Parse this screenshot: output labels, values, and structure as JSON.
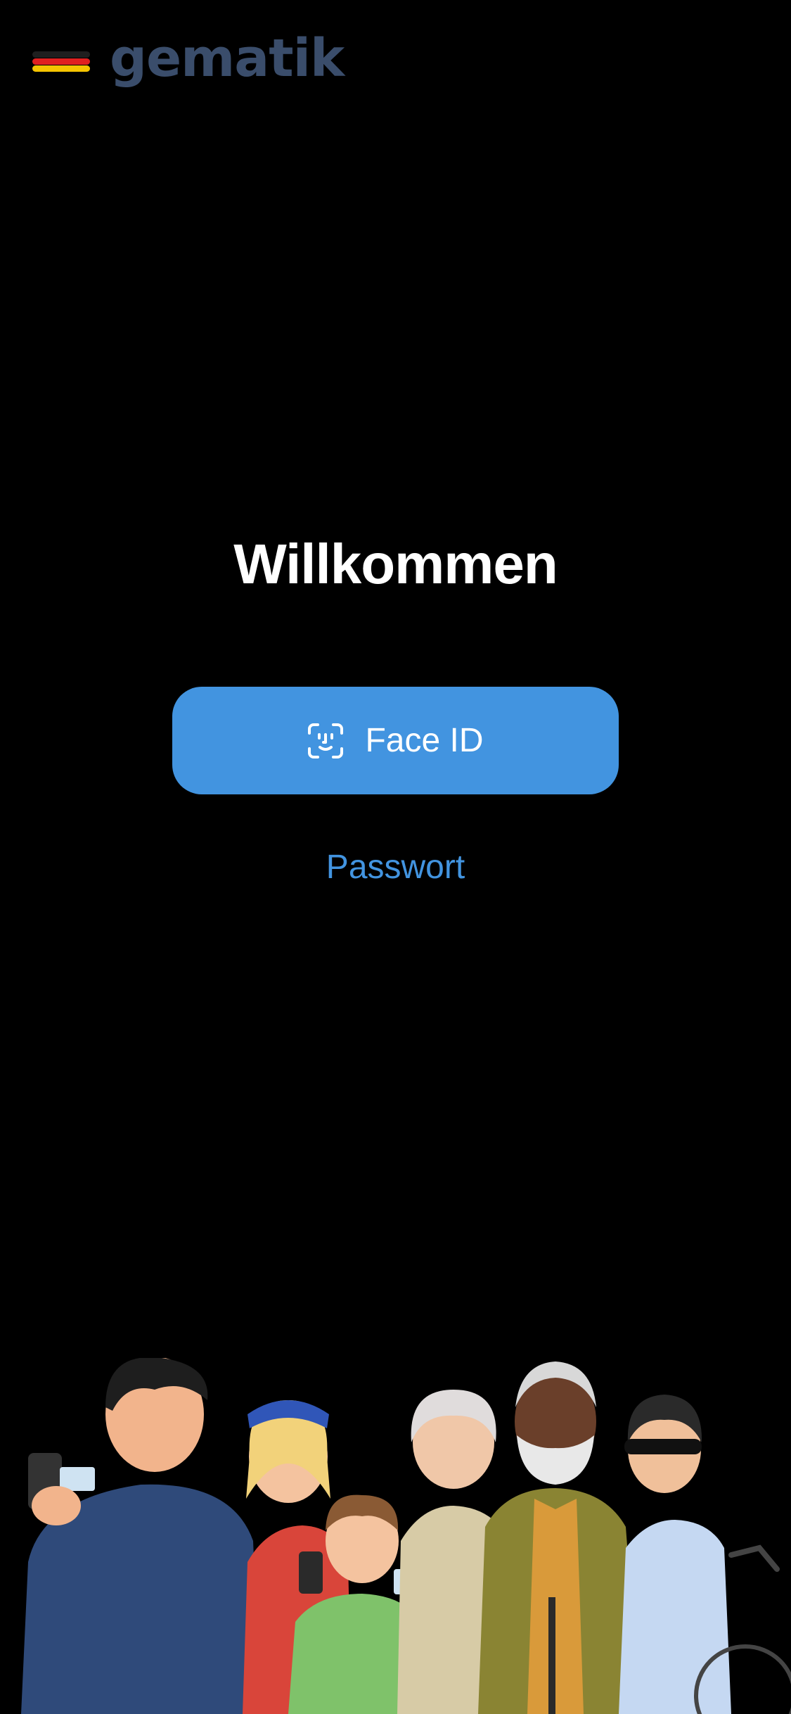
{
  "logo": {
    "wordmark": "gematik",
    "wordmark_color": "#3a4d6b",
    "stripe_colors": [
      "#1f1f1f",
      "#e02020",
      "#f5c400"
    ]
  },
  "welcome": {
    "title": "Willkommen"
  },
  "actions": {
    "face_id_label": "Face ID",
    "face_id_icon": "face-id-icon",
    "password_label": "Passwort"
  },
  "colors": {
    "background": "#000000",
    "accent": "#4294e0",
    "text": "#ffffff"
  }
}
